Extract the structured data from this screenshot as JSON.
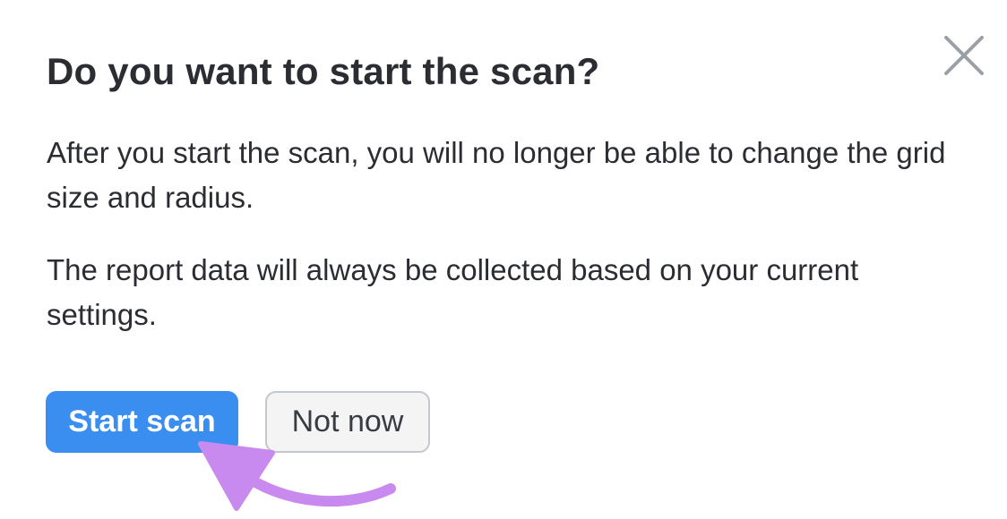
{
  "dialog": {
    "title": "Do you want to start the scan?",
    "paragraph_1": "After you start the scan, you will no longer be able to change the grid size and radius.",
    "paragraph_2": "The report data will always be collected based on your current settings.",
    "primary_button_label": "Start scan",
    "secondary_button_label": "Not now",
    "close_icon": "close-icon"
  },
  "colors": {
    "primary_button": "#3a8ef0",
    "secondary_button_bg": "#f4f4f5",
    "secondary_button_border": "#c4c7cc",
    "text": "#2b2d33",
    "close_icon": "#9aa0a6",
    "annotation_arrow": "#c98af0"
  },
  "annotation": {
    "arrow_icon": "curved-arrow-icon",
    "points_to": "start-scan-button"
  }
}
